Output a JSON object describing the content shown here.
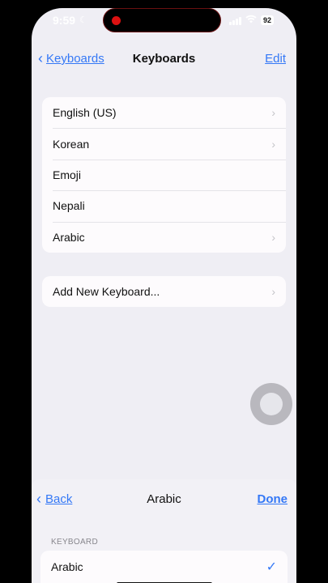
{
  "status_bar": {
    "time": "9:59",
    "battery": "92"
  },
  "nav": {
    "back_label": "Keyboards",
    "title": "Keyboards",
    "edit_label": "Edit"
  },
  "keyboards": [
    {
      "label": "English (US)",
      "chevron": true
    },
    {
      "label": "Korean",
      "chevron": true
    },
    {
      "label": "Emoji",
      "chevron": false
    },
    {
      "label": "Nepali",
      "chevron": false
    },
    {
      "label": "Arabic",
      "chevron": true
    }
  ],
  "add_keyboard": {
    "label": "Add New Keyboard..."
  },
  "sheet": {
    "back_label": "Back",
    "title": "Arabic",
    "done_label": "Done",
    "section_header": "KEYBOARD",
    "selected_row": {
      "label": "Arabic"
    }
  },
  "colors": {
    "accent": "#3478f6",
    "background": "#efeef4",
    "cell": "#fdfbfd"
  }
}
